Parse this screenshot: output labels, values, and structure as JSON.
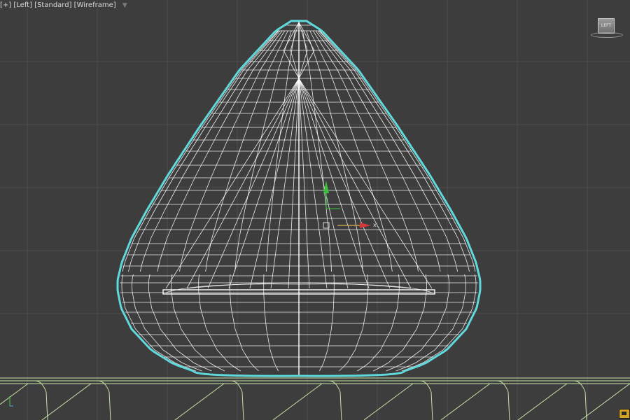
{
  "viewport": {
    "label_parts": [
      "[+]",
      "[Left]",
      "[Standard]",
      "[Wireframe]"
    ],
    "background_color": "#3d3d3d",
    "grid_color": "#4d4d4d",
    "selection_outline_color": "#5fd9dc",
    "wire_color": "#ffffff",
    "ground_color": "#c7e3a8"
  },
  "gizmo": {
    "x_axis_label": "x",
    "x_color": "#d23a3a",
    "y_color": "#39c239"
  },
  "viewcube": {
    "face_label": "LEFT"
  },
  "icons": {
    "filter": "filter-icon",
    "viewcube": "viewcube-icon",
    "axis_tripod": "axis-tripod-icon",
    "corner": "maximize-viewport-icon"
  }
}
